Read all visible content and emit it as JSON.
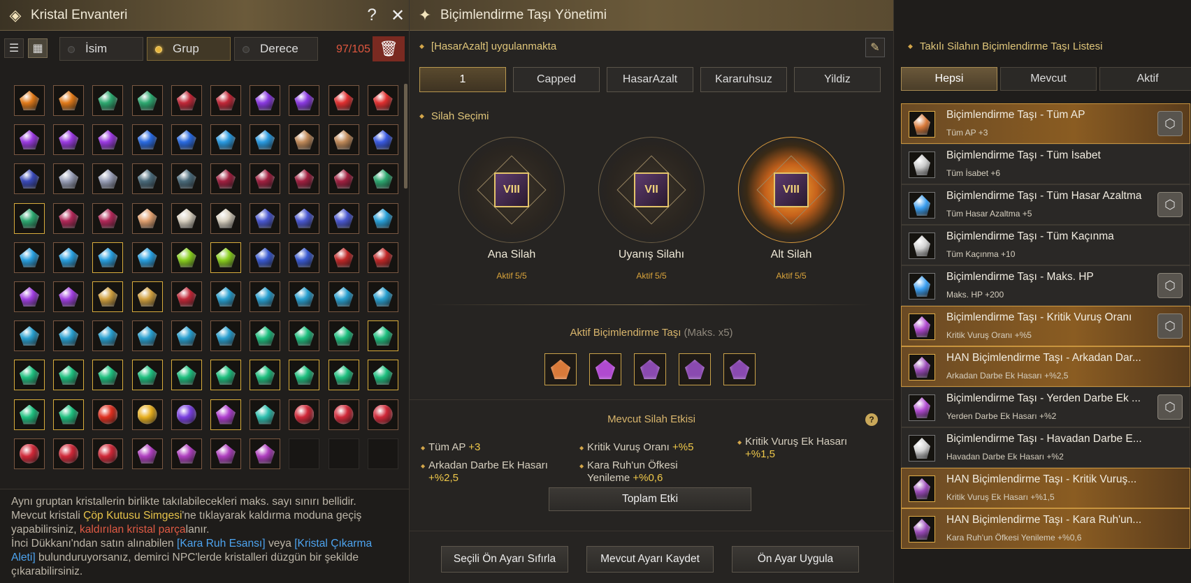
{
  "left": {
    "title": "Kristal Envanteri",
    "help": "?",
    "close": "✕",
    "sort": {
      "isim": "İsim",
      "grup": "Grup",
      "derece": "Derece"
    },
    "count": "97/105",
    "info": {
      "l1": "Aynı gruptan kristallerin birlikte takılabilecekleri maks. sayı sınırı bellidir.",
      "l2a": "Mevcut kristali ",
      "l2b": "Çöp Kutusu Simgesi",
      "l2c": "'ne tıklayarak kaldırma moduna geçiş yapabilirsiniz, ",
      "l2d": "kaldırılan kristal parça",
      "l2e": "lanır.",
      "l3a": "İnci Dükkanı'ndan satın alınabilen ",
      "l3b": "[Kara Ruh Esansı]",
      "l3c": " veya ",
      "l3d": "[Kristal Çıkarma Aleti]",
      "l3e": " bulunduruyorsanız, demirci NPC'lerde kristalleri düzgün bir şekilde çıkarabilirsiniz."
    }
  },
  "mid": {
    "title": "Biçimlendirme Taşı Yönetimi",
    "applied": "[HasarAzalt] uygulanmakta",
    "presets": [
      "1",
      "Capped",
      "HasarAzalt",
      "Kararuhsuz",
      "Yildiz"
    ],
    "weapon_section": "Silah Seçimi",
    "weapons": [
      {
        "name": "Ana Silah",
        "status": "Aktif 5/5",
        "grade": "VIII"
      },
      {
        "name": "Uyanış Silahı",
        "status": "Aktif 5/5",
        "grade": "VII"
      },
      {
        "name": "Alt Silah",
        "status": "Aktif 5/5",
        "grade": "VIII"
      }
    ],
    "active_label": "Aktif Biçimlendirme Taşı",
    "active_max": "(Maks. x5)",
    "effect_header": "Mevcut Silah Etkisi",
    "effects": {
      "e1l": "Tüm AP",
      "e1v": "+3",
      "e2l": "Kritik Vuruş Oranı",
      "e2v": "+%5",
      "e3l": "Kritik Vuruş Ek Hasarı",
      "e3v": "+%1,5",
      "e4l": "Arkadan Darbe Ek Hasarı",
      "e4v": "+%2,5",
      "e5l": "Kara Ruh'un Öfkesi Yenileme",
      "e5v": "+%0,6"
    },
    "total_button": "Toplam Etki",
    "buttons": [
      "Seçili Ön Ayarı Sıfırla",
      "Mevcut Ayarı Kaydet",
      "Ön Ayar Uygula"
    ]
  },
  "right": {
    "header": "Takılı Silahın Biçimlendirme Taşı Listesi",
    "tabs": [
      "Hepsi",
      "Mevcut",
      "Aktif"
    ],
    "items": [
      {
        "name": "Biçimlendirme Taşı - Tüm AP",
        "stat": "Tüm AP +3",
        "color": "#d97a3a"
      },
      {
        "name": "Biçimlendirme Taşı - Tüm İsabet",
        "stat": "Tüm İsabet +6",
        "color": "#c8c8c8"
      },
      {
        "name": "Biçimlendirme Taşı - Tüm Hasar Azaltma",
        "stat": "Tüm Hasar Azaltma +5",
        "color": "#3a9ef0"
      },
      {
        "name": "Biçimlendirme Taşı - Tüm Kaçınma",
        "stat": "Tüm Kaçınma +10",
        "color": "#d0d0d0"
      },
      {
        "name": "Biçimlendirme Taşı - Maks. HP",
        "stat": "Maks. HP +200",
        "color": "#3a9ef0"
      },
      {
        "name": "Biçimlendirme Taşı - Kritik Vuruş Oranı",
        "stat": "Kritik Vuruş Oranı +%5",
        "color": "#b04ad0"
      },
      {
        "name": "HAN Biçimlendirme Taşı - Arkadan Dar...",
        "stat": "Arkadan Darbe Ek Hasarı +%2,5",
        "color": "#9a4ab8"
      },
      {
        "name": "Biçimlendirme Taşı - Yerden Darbe Ek ...",
        "stat": "Yerden Darbe Ek Hasarı +%2",
        "color": "#b04ad0"
      },
      {
        "name": "Biçimlendirme Taşı - Havadan Darbe E...",
        "stat": "Havadan Darbe Ek Hasarı +%2",
        "color": "#cfcfcf"
      },
      {
        "name": "HAN Biçimlendirme Taşı - Kritik Vuruş...",
        "stat": "Kritik Vuruş Ek Hasarı +%1,5",
        "color": "#9a4ab8"
      },
      {
        "name": "HAN Biçimlendirme Taşı - Kara Ruh'un...",
        "stat": "Kara Ruh'un Öfkesi Yenileme +%0,6",
        "color": "#9a4ab8"
      }
    ]
  },
  "colors": {
    "accent": "#e0c67a",
    "gold": "#efc84a",
    "red": "#e05a44",
    "blue": "#4da4f0"
  }
}
